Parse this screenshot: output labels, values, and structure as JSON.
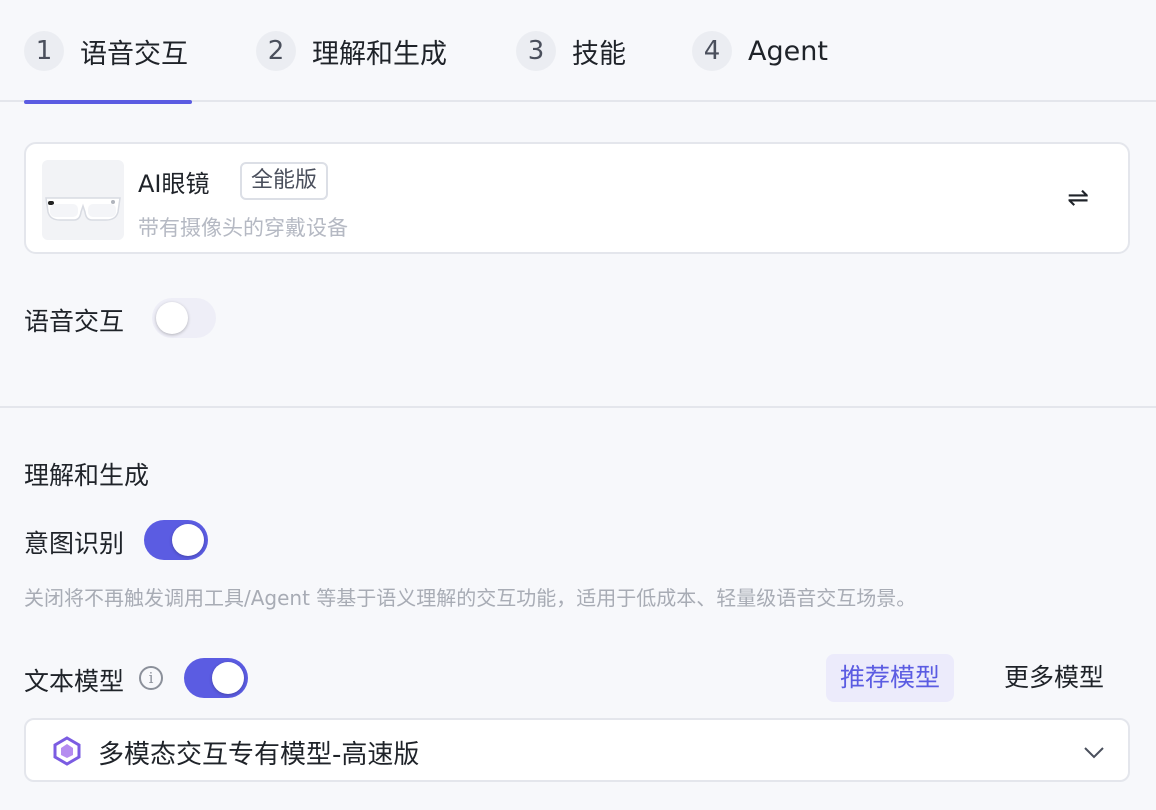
{
  "tabs": [
    {
      "num": "1",
      "label": "语音交互",
      "active": true
    },
    {
      "num": "2",
      "label": "理解和生成"
    },
    {
      "num": "3",
      "label": "技能"
    },
    {
      "num": "4",
      "label": "Agent"
    }
  ],
  "device": {
    "title": "AI眼镜",
    "badge": "全能版",
    "description": "带有摄像头的穿戴设备",
    "swap_icon": "⇌"
  },
  "voice_interaction": {
    "label": "语音交互",
    "enabled": false
  },
  "understanding": {
    "section_title": "理解和生成",
    "intent": {
      "label": "意图识别",
      "enabled": true
    },
    "intent_hint": "关闭将不再触发调用工具/Agent 等基于语义理解的交互功能，适用于低成本、轻量级语音交互场景。",
    "text_model": {
      "label": "文本模型",
      "enabled": true,
      "info_icon": "i"
    },
    "model_tabs": {
      "recommended": "推荐模型",
      "more": "更多模型"
    },
    "selected_model": "多模态交互专有模型-高速版"
  },
  "colors": {
    "accent": "#5b5ce2",
    "border": "#e4e6ec",
    "muted": "#a8acb5"
  }
}
